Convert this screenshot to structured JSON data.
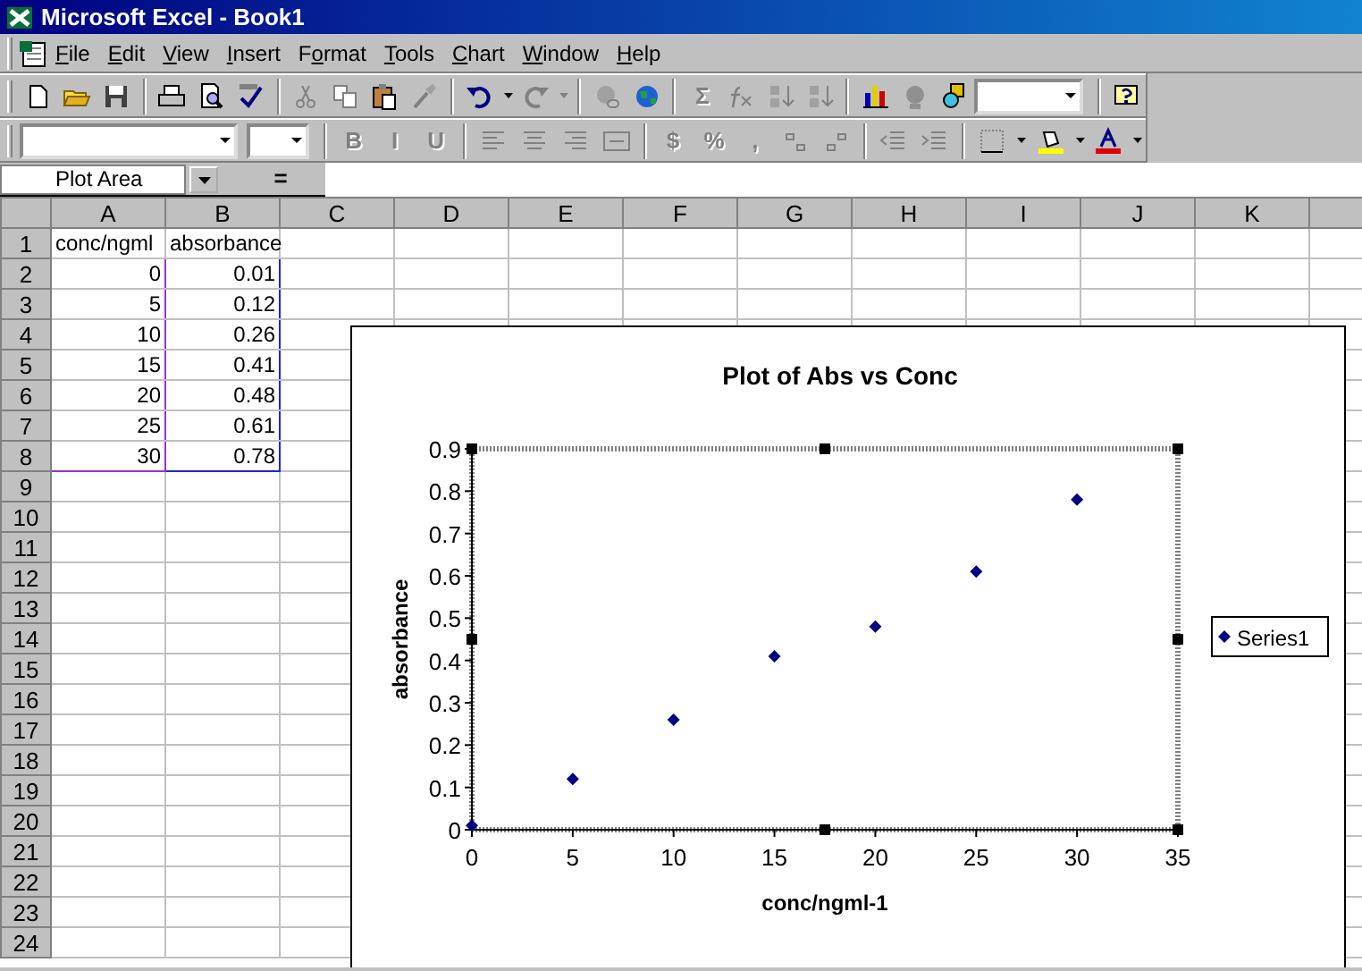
{
  "window": {
    "title": "Microsoft Excel - Book1"
  },
  "menu": [
    {
      "key": "F",
      "after": "ile"
    },
    {
      "key": "E",
      "after": "dit"
    },
    {
      "key": "V",
      "after": "iew"
    },
    {
      "key": "I",
      "after": "nsert"
    },
    {
      "before": "F",
      "key": "o",
      "after": "rmat"
    },
    {
      "key": "T",
      "after": "ools"
    },
    {
      "key": "C",
      "after": "hart"
    },
    {
      "key": "W",
      "after": "indow"
    },
    {
      "key": "H",
      "after": "elp"
    }
  ],
  "standard_toolbar": {
    "glyph_buttons": [
      {
        "label": "Σ",
        "disabled": true
      }
    ]
  },
  "formatting_toolbar": {
    "glyph_buttons": [
      {
        "label": "B",
        "disabled": true
      },
      {
        "label": "I",
        "disabled": true
      },
      {
        "label": "U",
        "disabled": true
      },
      {
        "label": "$",
        "disabled": true
      },
      {
        "label": "%",
        "disabled": true
      },
      {
        "label": ",",
        "disabled": true
      }
    ]
  },
  "formula_bar": {
    "name_box": "Plot Area",
    "equals": "="
  },
  "sheet": {
    "columns": [
      {
        "label": "A",
        "color": "#9933cc"
      },
      {
        "label": "B",
        "color": "#2222dd"
      },
      {
        "label": "C"
      },
      {
        "label": "D"
      },
      {
        "label": "E"
      },
      {
        "label": "F"
      },
      {
        "label": "G"
      },
      {
        "label": "H"
      },
      {
        "label": "I"
      },
      {
        "label": "J"
      },
      {
        "label": "K"
      }
    ],
    "rows": [
      {
        "label": "1",
        "cells": [
          {
            "text": "conc/ngml",
            "kind": "text",
            "in_range": false
          },
          {
            "text": "absorbance",
            "kind": "text",
            "in_range": false
          }
        ]
      },
      {
        "label": "2",
        "cells": [
          {
            "text": "0",
            "kind": "number",
            "in_range": true
          },
          {
            "text": "0.01",
            "kind": "number",
            "in_range": true
          }
        ]
      },
      {
        "label": "3",
        "cells": [
          {
            "text": "5",
            "kind": "number",
            "in_range": true
          },
          {
            "text": "0.12",
            "kind": "number",
            "in_range": true
          }
        ]
      },
      {
        "label": "4",
        "cells": [
          {
            "text": "10",
            "kind": "number",
            "in_range": true
          },
          {
            "text": "0.26",
            "kind": "number",
            "in_range": true
          }
        ]
      },
      {
        "label": "5",
        "cells": [
          {
            "text": "15",
            "kind": "number",
            "in_range": true
          },
          {
            "text": "0.41",
            "kind": "number",
            "in_range": true
          }
        ]
      },
      {
        "label": "6",
        "cells": [
          {
            "text": "20",
            "kind": "number",
            "in_range": true
          },
          {
            "text": "0.48",
            "kind": "number",
            "in_range": true
          }
        ]
      },
      {
        "label": "7",
        "cells": [
          {
            "text": "25",
            "kind": "number",
            "in_range": true
          },
          {
            "text": "0.61",
            "kind": "number",
            "in_range": true
          }
        ]
      },
      {
        "label": "8",
        "cells": [
          {
            "text": "30",
            "kind": "number",
            "in_range": true
          },
          {
            "text": "0.78",
            "kind": "number",
            "in_range": true
          }
        ]
      },
      {
        "label": "9"
      },
      {
        "label": "10"
      },
      {
        "label": "11"
      },
      {
        "label": "12"
      },
      {
        "label": "13"
      },
      {
        "label": "14"
      },
      {
        "label": "15"
      },
      {
        "label": "16"
      },
      {
        "label": "17"
      },
      {
        "label": "18"
      },
      {
        "label": "19"
      },
      {
        "label": "20"
      },
      {
        "label": "21"
      },
      {
        "label": "22"
      },
      {
        "label": "23"
      },
      {
        "label": "24"
      }
    ]
  },
  "chart": {
    "plot_area_selected": true,
    "chart_data": {
      "type": "scatter",
      "title": "Plot of Abs vs Conc",
      "xlabel": "conc/ngml-1",
      "ylabel": "absorbance",
      "x": [
        0,
        5,
        10,
        15,
        20,
        25,
        30
      ],
      "series": [
        {
          "name": "Series1",
          "color": "#000080",
          "values": [
            0.01,
            0.12,
            0.26,
            0.41,
            0.48,
            0.61,
            0.78
          ]
        }
      ],
      "xlim": [
        0,
        35
      ],
      "ylim": [
        0,
        0.9
      ],
      "xticks": [
        0,
        5,
        10,
        15,
        20,
        25,
        30,
        35
      ],
      "yticks": [
        {
          "value": 0,
          "label": "0"
        },
        {
          "value": 0.1,
          "label": "0.1"
        },
        {
          "value": 0.2,
          "label": "0.2"
        },
        {
          "value": 0.3,
          "label": "0.3"
        },
        {
          "value": 0.4,
          "label": "0.4"
        },
        {
          "value": 0.5,
          "label": "0.5"
        },
        {
          "value": 0.6,
          "label": "0.6"
        },
        {
          "value": 0.7,
          "label": "0.7"
        },
        {
          "value": 0.8,
          "label": "0.8"
        },
        {
          "value": 0.9,
          "label": "0.9"
        }
      ]
    }
  }
}
